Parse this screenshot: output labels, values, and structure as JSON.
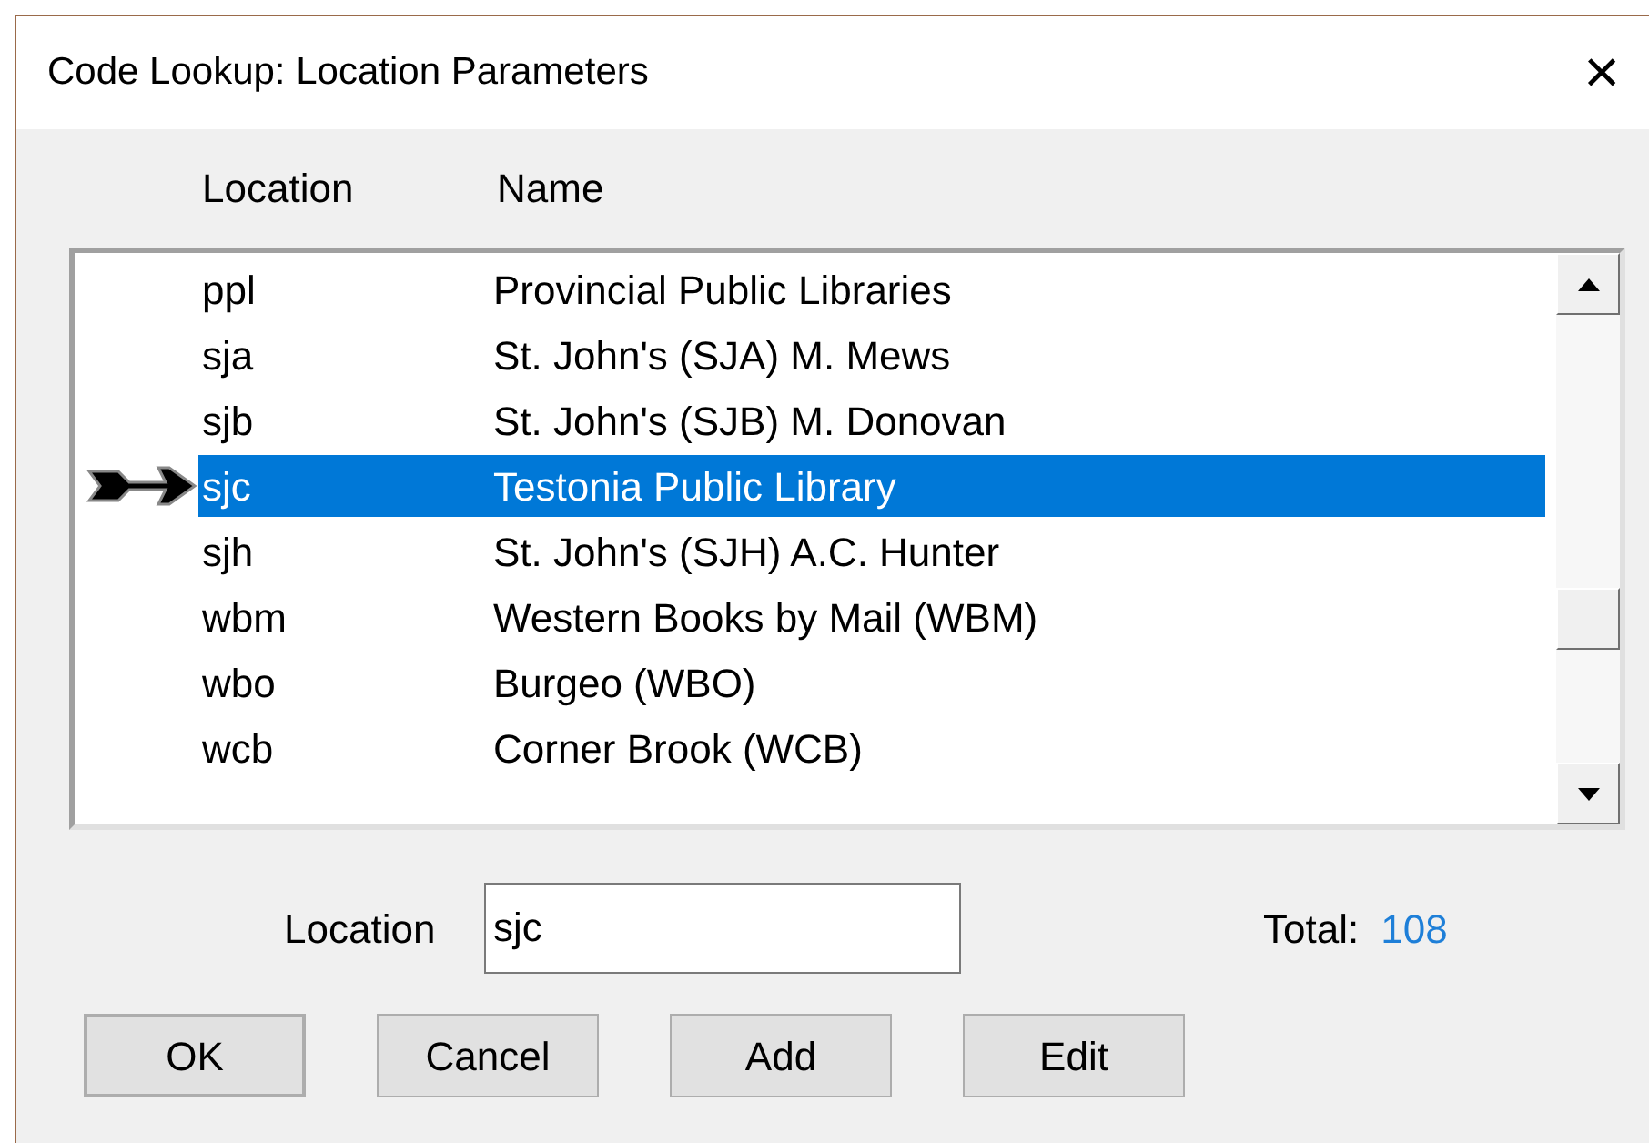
{
  "window": {
    "title": "Code Lookup: Location Parameters",
    "close": "×"
  },
  "table": {
    "columns": [
      "Location",
      "Name"
    ],
    "rows": [
      {
        "code": "ppl",
        "name": "Provincial Public Libraries",
        "selected": false
      },
      {
        "code": "sja",
        "name": "St. John's (SJA) M. Mews",
        "selected": false
      },
      {
        "code": "sjb",
        "name": "St. John's (SJB) M. Donovan",
        "selected": false
      },
      {
        "code": "sjc",
        "name": "Testonia Public Library",
        "selected": true
      },
      {
        "code": "sjh",
        "name": "St. John's (SJH) A.C. Hunter",
        "selected": false
      },
      {
        "code": "wbm",
        "name": "Western Books by Mail (WBM)",
        "selected": false
      },
      {
        "code": "wbo",
        "name": "Burgeo (WBO)",
        "selected": false
      },
      {
        "code": "wcb",
        "name": "Corner Brook (WCB)",
        "selected": false
      }
    ]
  },
  "location_field": {
    "label": "Location",
    "value": "sjc"
  },
  "total": {
    "label": "Total:",
    "value": "108"
  },
  "buttons": [
    "OK",
    "Cancel",
    "Add",
    "Edit"
  ]
}
